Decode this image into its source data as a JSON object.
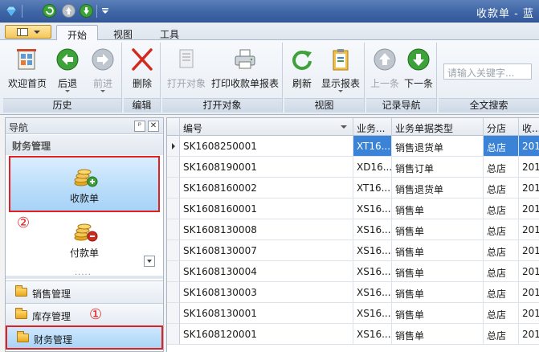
{
  "window": {
    "title": "收款单 - 蓝"
  },
  "tabs": [
    {
      "label": "开始",
      "active": true
    },
    {
      "label": "视图",
      "active": false
    },
    {
      "label": "工具",
      "active": false
    }
  ],
  "ribbon": {
    "groups": {
      "history": "历史",
      "edit": "编辑",
      "open": "打开对象",
      "view": "视图",
      "record_nav": "记录导航",
      "fulltext": "全文搜索"
    },
    "buttons": {
      "home": "欢迎首页",
      "back": "后退",
      "forward": "前进",
      "delete": "删除",
      "open_object": "打开对象",
      "print_report": "打印收款单报表",
      "refresh": "刷新",
      "show_report": "显示报表",
      "prev": "上一条",
      "next": "下一条"
    },
    "search_placeholder": "请输入关键字..."
  },
  "nav": {
    "header": "导航",
    "pin": "ᵖ",
    "close": "✕",
    "section": "财务管理",
    "items": [
      {
        "label": "收款单",
        "selected": true
      },
      {
        "label": "付款单",
        "selected": false
      }
    ],
    "groups": [
      {
        "label": "销售管理",
        "selected": false
      },
      {
        "label": "库存管理",
        "selected": false
      },
      {
        "label": "财务管理",
        "selected": true
      }
    ],
    "annotations": {
      "one": "①",
      "two": "②"
    }
  },
  "grid": {
    "columns": [
      "编号",
      "业务...",
      "业务单据类型",
      "分店",
      "收..."
    ],
    "rows": [
      [
        "SK1608250001",
        "XT16...",
        "销售退货单",
        "总店",
        "201"
      ],
      [
        "SK1608190001",
        "XD16...",
        "销售订单",
        "总店",
        "201"
      ],
      [
        "SK1608160002",
        "XT16...",
        "销售退货单",
        "总店",
        "201"
      ],
      [
        "SK1608160001",
        "XS16...",
        "销售单",
        "总店",
        "201"
      ],
      [
        "SK1608130008",
        "XS16...",
        "销售单",
        "总店",
        "201"
      ],
      [
        "SK1608130007",
        "XS16...",
        "销售单",
        "总店",
        "201"
      ],
      [
        "SK1608130004",
        "XS16...",
        "销售单",
        "总店",
        "201"
      ],
      [
        "SK1608130003",
        "XS16...",
        "销售单",
        "总店",
        "201"
      ],
      [
        "SK1608130001",
        "XS16...",
        "销售单",
        "总店",
        "201"
      ],
      [
        "SK1608120001",
        "XS16...",
        "销售单",
        "总店",
        "201"
      ]
    ],
    "selected_row": 0
  },
  "colors": {
    "accent_red": "#e32020",
    "selection_blue": "#3b83d6"
  }
}
